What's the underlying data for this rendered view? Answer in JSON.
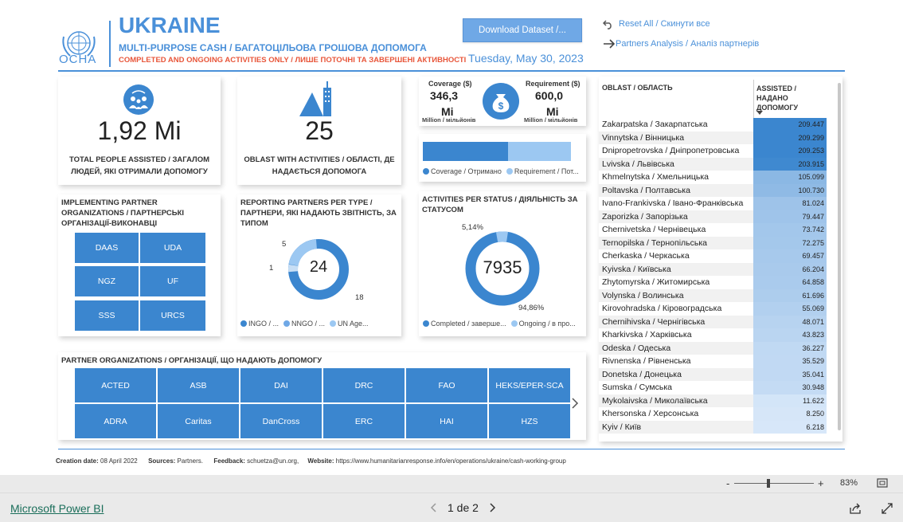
{
  "header": {
    "logo_text": "OCHA",
    "title": "UKRAINE",
    "subtitle": "MULTI-PURPOSE CASH / БАГАТОЦІЛЬОВА ГРОШОВА ДОПОМОГА",
    "subtitle2": "COMPLETED AND ONGOING ACTIVITIES ONLY / ЛИШЕ ПОТОЧНІ ТА ЗАВЕРШЕНІ АКТИВНОСТІ",
    "download_label": "Download Dataset /...",
    "date": "Tuesday, May 30, 2023",
    "reset_label": "Reset All / Скинути все",
    "partners_label": "Partners Analysis / Аналіз партнерів"
  },
  "kpi_people": {
    "value": "1,92 Mi",
    "label": "TOTAL PEOPLE ASSISTED / ЗАГАЛОМ ЛЮДЕЙ, ЯКІ ОТРИМАЛИ ДОПОМОГУ"
  },
  "kpi_oblast": {
    "value": "25",
    "label": "OBLAST WITH ACTIVITIES / ОБЛАСТІ, ДЕ НАДАЄТЬСЯ ДОПОМОГА"
  },
  "coverage": {
    "coverage_title": "Coverage ($)",
    "coverage_value": "346,3",
    "coverage_unit": "Mi",
    "coverage_sub": "Million / мільйонів",
    "req_title": "Requirement ($)",
    "req_value": "600,0",
    "req_unit": "Mi",
    "req_sub": "Million / мільйонів",
    "bar_fraction": 0.577,
    "legend_a": "Coverage / Отримано",
    "legend_b": "Requirement / Пот..."
  },
  "implementing": {
    "title": "IMPLEMENTING PARTNER ORGANIZATIONS / ПАРТНЕРСЬКІ ОРГАНІЗАЦІЇ-ВИКОНАВЦІ",
    "tiles": [
      "DAAS",
      "UDA",
      "NGZ",
      "UF",
      "SSS",
      "URCS"
    ]
  },
  "reporting": {
    "title": "REPORTING PARTNERS PER TYPE / ПАРТНЕРИ, ЯКІ НАДАЮТЬ ЗВІТНІСТЬ, ЗА ТИПОМ",
    "total": "24",
    "labels": [
      "5",
      "1",
      "18"
    ],
    "legend": [
      "INGO / ...",
      "NNGO / ...",
      "UN Age..."
    ]
  },
  "activities": {
    "title": "ACTIVITIES PER STATUS / ДІЯЛЬНІСТЬ ЗА СТАТУСОМ",
    "total": "7935",
    "pct_ongoing": "5,14%",
    "pct_completed": "94,86%",
    "legend": [
      "Completed / заверше...",
      "Ongoing / в про..."
    ]
  },
  "partners": {
    "title": "PARTNER ORGANIZATIONS / ОРГАНІЗАЦІЇ, ЩО НАДАЮТЬ ДОПОМОГУ",
    "row1": [
      "ACTED",
      "ASB",
      "DAI",
      "DRC",
      "FAO",
      "HEKS/EPER-SCA"
    ],
    "row2": [
      "ADRA",
      "Caritas",
      "DanCross",
      "ERC",
      "HAI",
      "HZS"
    ]
  },
  "table": {
    "col1": "OBLAST / ОБЛАСТЬ",
    "col2": "ASSISTED / НАДАНО ДОПОМОГУ",
    "rows": [
      {
        "name": "Zakarpatska / Закарпатська",
        "value": "209.447",
        "fill": 1.0
      },
      {
        "name": "Vinnytska / Вінницька",
        "value": "209.299",
        "fill": 0.999
      },
      {
        "name": "Dnipropetrovska / Дніпропетровська",
        "value": "209.253",
        "fill": 0.999
      },
      {
        "name": "Lvivska / Львівська",
        "value": "203.915",
        "fill": 0.974
      },
      {
        "name": "Khmelnytska / Хмельницька",
        "value": "105.099",
        "fill": 0.502
      },
      {
        "name": "Poltavska / Полтавська",
        "value": "100.730",
        "fill": 0.481
      },
      {
        "name": "Ivano-Frankivska / Івано-Франківська",
        "value": "81.024",
        "fill": 0.387
      },
      {
        "name": "Zaporizka / Запорізька",
        "value": "79.447",
        "fill": 0.379
      },
      {
        "name": "Chernivetska / Чернівецька",
        "value": "73.742",
        "fill": 0.352
      },
      {
        "name": "Ternopilska / Тернопільська",
        "value": "72.275",
        "fill": 0.345
      },
      {
        "name": "Cherkaska / Черкаська",
        "value": "69.457",
        "fill": 0.332
      },
      {
        "name": "Kyivska / Київська",
        "value": "66.204",
        "fill": 0.316
      },
      {
        "name": "Zhytomyrska / Житомирська",
        "value": "64.858",
        "fill": 0.31
      },
      {
        "name": "Volynska / Волинська",
        "value": "61.696",
        "fill": 0.295
      },
      {
        "name": "Kirovohradska / Кіровоградська",
        "value": "55.069",
        "fill": 0.263
      },
      {
        "name": "Chernihivska / Чернігівська",
        "value": "48.071",
        "fill": 0.23
      },
      {
        "name": "Kharkivska / Харківська",
        "value": "43.823",
        "fill": 0.209
      },
      {
        "name": "Odeska / Одеська",
        "value": "36.227",
        "fill": 0.173
      },
      {
        "name": "Rivnenska / Рівненська",
        "value": "35.529",
        "fill": 0.17
      },
      {
        "name": "Donetska / Донецька",
        "value": "35.041",
        "fill": 0.167
      },
      {
        "name": "Sumska / Сумська",
        "value": "30.948",
        "fill": 0.148
      },
      {
        "name": "Mykolaivska / Миколаївська",
        "value": "11.622",
        "fill": 0.055
      },
      {
        "name": "Khersonska / Херсонська",
        "value": "8.250",
        "fill": 0.039
      },
      {
        "name": "Kyiv / Київ",
        "value": "6.218",
        "fill": 0.03
      }
    ]
  },
  "footer": {
    "creation_label": "Creation date:",
    "creation_value": "08 April 2022",
    "sources_label": "Sources:",
    "sources_value": "Partners.",
    "feedback_label": "Feedback:",
    "feedback_value": "schuetza@un.org,",
    "website_label": "Website:",
    "website_value": "https://www.humanitarianresponse.info/en/operations/ukraine/cash-working-group"
  },
  "zoom": {
    "minus": "-",
    "plus": "+",
    "level": "83%",
    "slider_fraction": 0.43
  },
  "bottom": {
    "brand": "Microsoft Power BI",
    "page": "1 de 2"
  },
  "colors": {
    "primary": "#4a90d9",
    "tile": "#3b86cf",
    "light": "#9cc8f2",
    "accent": "#e8563a"
  }
}
